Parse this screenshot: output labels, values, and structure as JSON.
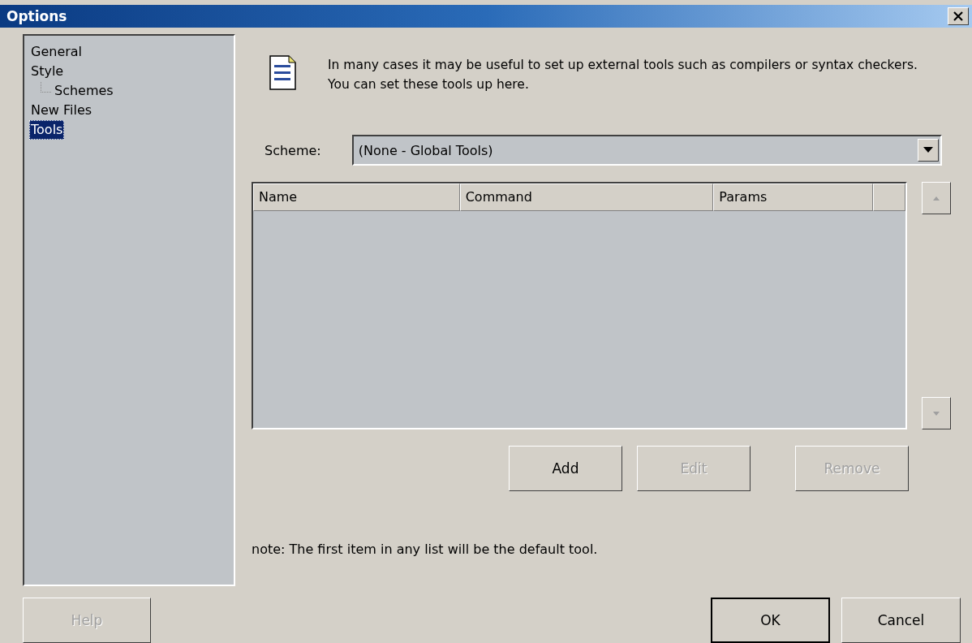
{
  "window": {
    "title": "Options"
  },
  "sidebar": {
    "items": [
      {
        "label": "General",
        "selected": false
      },
      {
        "label": "Style",
        "selected": false,
        "children": [
          {
            "label": "Schemes",
            "selected": false
          }
        ]
      },
      {
        "label": "New Files",
        "selected": false
      },
      {
        "label": "Tools",
        "selected": true
      }
    ]
  },
  "description": "In many cases it may be useful to set up external tools such as compilers or syntax checkers. You can set these tools up here.",
  "scheme": {
    "label": "Scheme:",
    "value": "(None - Global Tools)"
  },
  "table": {
    "columns": [
      "Name",
      "Command",
      "Params"
    ]
  },
  "list_buttons": [
    {
      "label": "Add",
      "disabled": false
    },
    {
      "label": "Edit",
      "disabled": true
    },
    {
      "label": "Remove",
      "disabled": true
    }
  ],
  "note": "note: The first item in any list will be the default tool.",
  "help": {
    "label": "Help",
    "disabled": true
  },
  "dialog_buttons": [
    {
      "label": "OK",
      "default": true
    },
    {
      "label": "Cancel",
      "default": false
    }
  ]
}
